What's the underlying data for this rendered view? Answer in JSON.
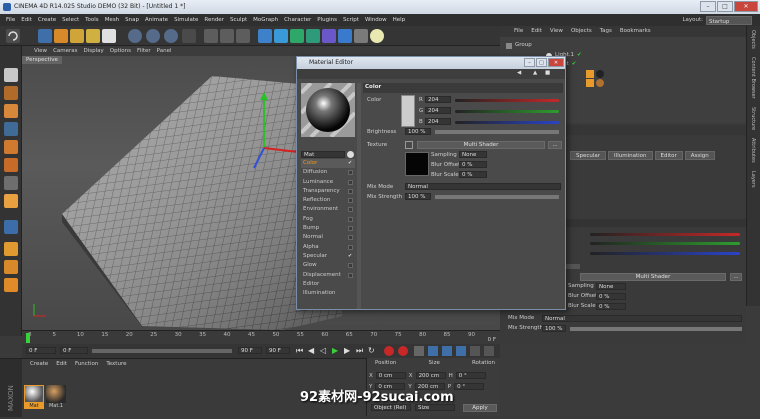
{
  "window": {
    "title": "CINEMA 4D R14.025 Studio DEMO (32 Bit) - [Untitled 1 *]"
  },
  "menu": [
    "File",
    "Edit",
    "Create",
    "Select",
    "Tools",
    "Mesh",
    "Snap",
    "Animate",
    "Simulate",
    "Render",
    "Sculpt",
    "MoGraph",
    "Character",
    "Plugins",
    "Script",
    "Window",
    "Help"
  ],
  "layout": {
    "label": "Layout:",
    "value": "Startup"
  },
  "viewport": {
    "menu": [
      "View",
      "Cameras",
      "Display",
      "Options",
      "Filter",
      "Panel"
    ],
    "tab": "Perspective"
  },
  "objects": {
    "menu": [
      "File",
      "Edit",
      "View",
      "Objects",
      "Tags",
      "Bookmarks"
    ],
    "items": [
      "Group",
      "Light.1",
      "Light"
    ]
  },
  "side_tabs": [
    "Objects",
    "Content Browser",
    "Structure",
    "Attributes",
    "Layers"
  ],
  "attributes": {
    "tabs": [
      "Specular",
      "Illumination",
      "Editor",
      "Assign"
    ],
    "shader_btn": "Multi Shader",
    "sampling_label": "Sampling",
    "sampling_value": "None",
    "blur_offset_label": "Blur Offset",
    "blur_offset_value": "0 %",
    "blur_scale_label": "Blur Scale",
    "blur_scale_value": "0 %",
    "mix_mode_label": "Mix Mode",
    "mix_mode_value": "Normal",
    "mix_strength_label": "Mix Strength",
    "mix_strength_value": "100 %"
  },
  "timeline": {
    "ticks": [
      "0",
      "5",
      "10",
      "15",
      "20",
      "25",
      "30",
      "35",
      "40",
      "45",
      "50",
      "55",
      "60",
      "65",
      "70",
      "75",
      "80",
      "85",
      "90"
    ],
    "end_label": "0 F",
    "start_field": "0 F",
    "current_field": "0 F",
    "end_field": "90 F",
    "max_field": "90 F"
  },
  "material_manager": {
    "menu": [
      "Create",
      "Edit",
      "Function",
      "Texture"
    ],
    "materials": [
      "Mat",
      "Mat.1"
    ]
  },
  "coordinates": {
    "headers": [
      "Position",
      "Size",
      "Rotation"
    ],
    "rows": [
      {
        "p": "0 cm",
        "s": "200 cm",
        "r": "0 °",
        "pl": "X",
        "sl": "X",
        "rl": "H"
      },
      {
        "p": "0 cm",
        "s": "200 cm",
        "r": "0 °",
        "pl": "Y",
        "sl": "Y",
        "rl": "P"
      }
    ],
    "mode": "Object (Rel)",
    "size_mode": "Size",
    "apply": "Apply"
  },
  "material_editor": {
    "title": "Material Editor",
    "mat_name": "Mat",
    "section": "Color",
    "color_label": "Color",
    "r": "204",
    "g": "204",
    "b": "204",
    "brightness_label": "Brightness",
    "brightness_value": "100 %",
    "texture_label": "Texture",
    "texture_shader": "Multi Shader",
    "more_btn": "...",
    "sampling_label": "Sampling",
    "sampling_value": "None",
    "blur_offset_label": "Blur Offset",
    "blur_offset_value": "0 %",
    "blur_scale_label": "Blur Scale",
    "blur_scale_value": "0 %",
    "mix_mode_label": "Mix Mode",
    "mix_mode_value": "Normal",
    "mix_strength_label": "Mix Strength",
    "mix_strength_value": "100 %",
    "channels": [
      {
        "name": "Color",
        "on": true
      },
      {
        "name": "Diffusion",
        "on": false
      },
      {
        "name": "Luminance",
        "on": false
      },
      {
        "name": "Transparency",
        "on": false
      },
      {
        "name": "Reflection",
        "on": false
      },
      {
        "name": "Environment",
        "on": false
      },
      {
        "name": "Fog",
        "on": false
      },
      {
        "name": "Bump",
        "on": false
      },
      {
        "name": "Normal",
        "on": false
      },
      {
        "name": "Alpha",
        "on": false
      },
      {
        "name": "Specular",
        "on": true
      },
      {
        "name": "Glow",
        "on": false
      },
      {
        "name": "Displacement",
        "on": false
      },
      {
        "name": "Editor",
        "on": null
      },
      {
        "name": "Illumination",
        "on": null
      }
    ],
    "rgb_labels": [
      "R",
      "G",
      "B"
    ]
  },
  "watermark": "92素材网-92sucai.com",
  "colors": {
    "accent": "#e89a2a",
    "red": "#c62828",
    "green": "#2e9d2e",
    "blue": "#2a43c8"
  }
}
